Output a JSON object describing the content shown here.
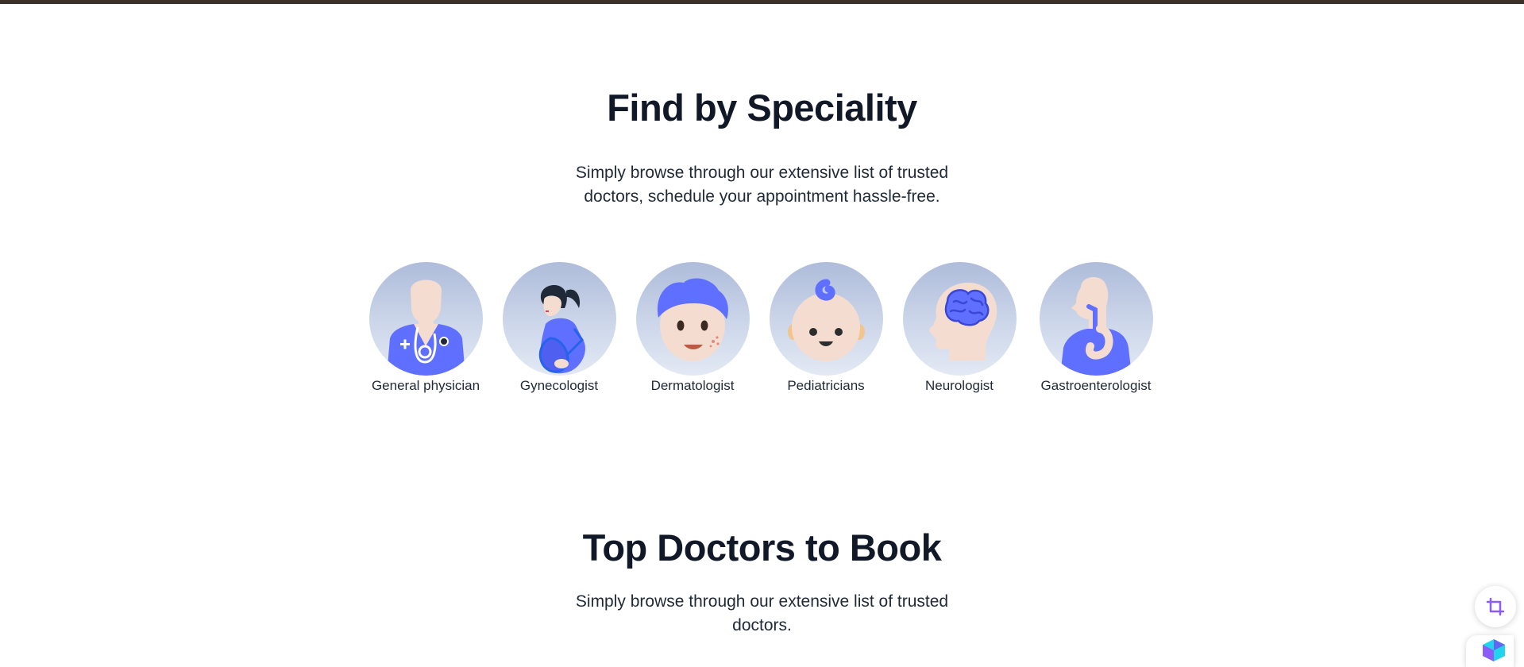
{
  "speciality": {
    "title": "Find by Speciality",
    "description_lines": [
      "Simply browse through our extensive list of trusted",
      "doctors, schedule your appointment hassle-free."
    ],
    "items": [
      {
        "label": "General physician",
        "icon": "general-physician-icon"
      },
      {
        "label": "Gynecologist",
        "icon": "gynecologist-icon"
      },
      {
        "label": "Dermatologist",
        "icon": "dermatologist-icon"
      },
      {
        "label": "Pediatricians",
        "icon": "pediatrician-icon"
      },
      {
        "label": "Neurologist",
        "icon": "neurologist-icon"
      },
      {
        "label": "Gastroenterologist",
        "icon": "gastroenterologist-icon"
      }
    ]
  },
  "top_doctors": {
    "title": "Top Doctors to Book",
    "description_lines": [
      "Simply browse through our extensive list of trusted",
      "doctors."
    ]
  },
  "floating": {
    "crop_icon": "crop-icon",
    "extension_icon": "extension-logo-icon"
  },
  "colors": {
    "accent_blue": "#5f6fff",
    "skin": "#f4ddd0",
    "circle_top": "#aebcda",
    "circle_bottom": "#e3e9f4",
    "heading": "#111827",
    "topbar": "#3b3129",
    "crop_purple": "#8b5cf6"
  }
}
